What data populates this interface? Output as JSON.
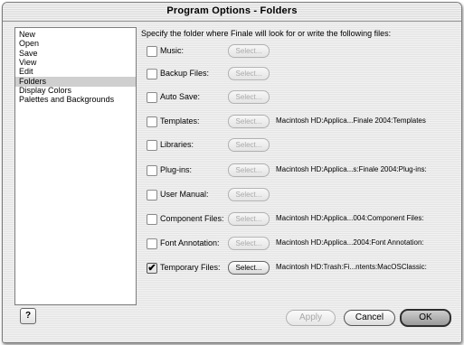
{
  "window": {
    "title": "Program Options - Folders"
  },
  "sidebar": {
    "items": [
      {
        "label": "New",
        "selected": false
      },
      {
        "label": "Open",
        "selected": false
      },
      {
        "label": "Save",
        "selected": false
      },
      {
        "label": "View",
        "selected": false
      },
      {
        "label": "Edit",
        "selected": false
      },
      {
        "label": "Folders",
        "selected": true
      },
      {
        "label": "Display Colors",
        "selected": false
      },
      {
        "label": "Palettes and Backgrounds",
        "selected": false
      }
    ]
  },
  "main": {
    "instructions": "Specify the folder where Finale will look for or write the following files:",
    "select_label": "Select...",
    "rows": [
      {
        "label": "Music:",
        "checked": false,
        "enabled": false,
        "path": ""
      },
      {
        "label": "Backup Files:",
        "checked": false,
        "enabled": false,
        "path": ""
      },
      {
        "label": "Auto Save:",
        "checked": false,
        "enabled": false,
        "path": ""
      },
      {
        "label": "Templates:",
        "checked": false,
        "enabled": false,
        "path": "Macintosh HD:Applica...Finale 2004:Templates"
      },
      {
        "label": "Libraries:",
        "checked": false,
        "enabled": false,
        "path": ""
      },
      {
        "label": "Plug-ins:",
        "checked": false,
        "enabled": false,
        "path": "Macintosh HD:Applica...s:Finale 2004:Plug-ins:"
      },
      {
        "label": "User Manual:",
        "checked": false,
        "enabled": false,
        "path": ""
      },
      {
        "label": "Component Files:",
        "checked": false,
        "enabled": false,
        "path": "Macintosh HD:Applica...004:Component Files:"
      },
      {
        "label": "Font Annotation:",
        "checked": false,
        "enabled": false,
        "path": "Macintosh HD:Applica...2004:Font Annotation:"
      },
      {
        "label": "Temporary Files:",
        "checked": true,
        "enabled": true,
        "path": "Macintosh HD:Trash:Fi...ntents:MacOSClassic:"
      }
    ]
  },
  "footer": {
    "help_label": "?",
    "apply_label": "Apply",
    "cancel_label": "Cancel",
    "ok_label": "OK"
  }
}
